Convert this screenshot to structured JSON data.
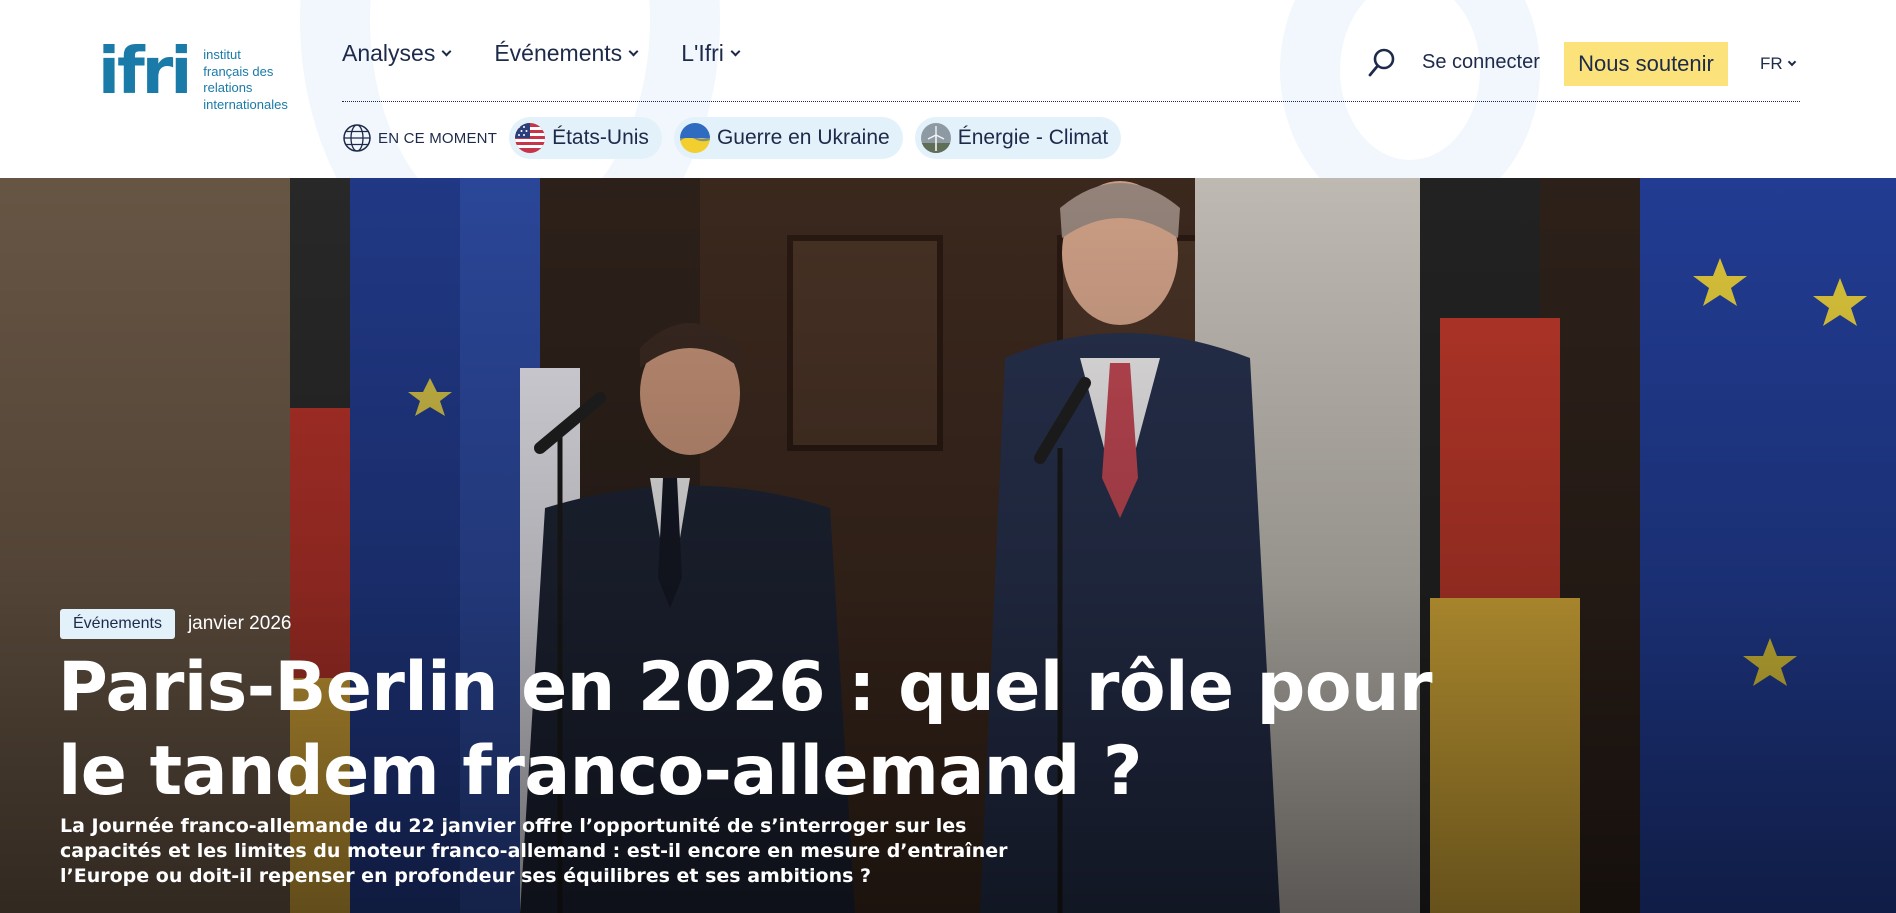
{
  "header": {
    "logo": {
      "mark": "ifri",
      "lines": [
        "institut",
        "français des",
        "relations",
        "internationales"
      ]
    },
    "nav": [
      {
        "label": "Analyses",
        "icon": "chevron-down-icon"
      },
      {
        "label": "Événements",
        "icon": "chevron-down-icon"
      },
      {
        "label": "L'Ifri",
        "icon": "chevron-down-icon"
      }
    ],
    "search_icon": "search-icon",
    "login_label": "Se connecter",
    "support_label": "Nous soutenir",
    "language": "FR",
    "colors": {
      "brand": "#1a7aa8",
      "text": "#1d2a4a",
      "support_button": "#fbe27b",
      "chip_background": "#e3f1fa"
    }
  },
  "trending": {
    "icon": "globe-icon",
    "label": "EN CE MOMENT",
    "chips": [
      {
        "label": "États-Unis",
        "icon": "us-flag-thumbnail"
      },
      {
        "label": "Guerre en Ukraine",
        "icon": "ukraine-flag-thumbnail"
      },
      {
        "label": "Énergie - Climat",
        "icon": "wind-turbine-thumbnail"
      }
    ]
  },
  "hero": {
    "tag": "Événements",
    "date": "janvier 2026",
    "title_line1": "Paris-Berlin en 2026 : quel rôle pour",
    "title_line2": "le tandem franco-allemand ?",
    "lede_line1": "La Journée franco-allemande du 22 janvier offre l’opportunité de s’interroger sur les",
    "lede_line2": "capacités et les limites du moteur franco-allemand : est-il encore en mesure d’entraîner",
    "lede_line3": "l’Europe ou doit-il repenser en profondeur ses équilibres et ses ambitions ?"
  }
}
